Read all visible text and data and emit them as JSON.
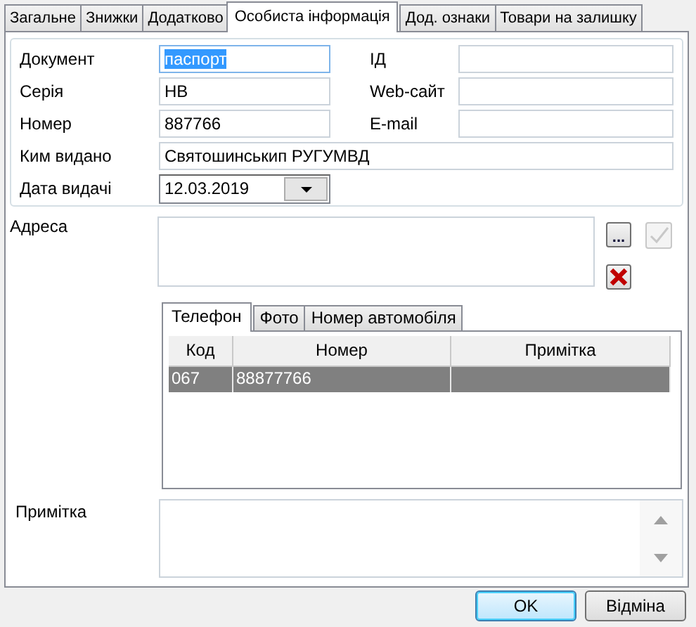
{
  "tabs": [
    {
      "label": "Загальне",
      "selected": false
    },
    {
      "label": "Знижки",
      "selected": false
    },
    {
      "label": "Додатково",
      "selected": false
    },
    {
      "label": "Особиста інформація",
      "selected": true
    },
    {
      "label": "Дод. ознаки",
      "selected": false
    },
    {
      "label": "Товари на залишку",
      "selected": false
    }
  ],
  "personal": {
    "document": {
      "label": "Документ",
      "value": "паспорт",
      "highlighted": true
    },
    "id": {
      "label": "ІД"
    },
    "series": {
      "label": "Серія",
      "value": "НВ"
    },
    "website": {
      "label": "Web-сайт"
    },
    "number": {
      "label": "Номер",
      "value": "887766"
    },
    "email": {
      "label": "E-mail"
    },
    "issued_by": {
      "label": "Ким видано",
      "value": "Святошинськип РУГУМВД"
    },
    "issue_date": {
      "label": "Дата видачі",
      "value": "12.03.2019"
    }
  },
  "address": {
    "label": "Адреса",
    "browse_button": "...",
    "confirm_disabled": true
  },
  "contact_tabs": [
    {
      "label": "Телефон",
      "selected": true
    },
    {
      "label": "Фото",
      "selected": false
    },
    {
      "label": "Номер автомобіля",
      "selected": false
    }
  ],
  "phones": {
    "columns": [
      "Код",
      "Номер",
      "Примітка"
    ],
    "rows": [
      {
        "cells": [
          "067",
          "88877766",
          ""
        ],
        "selected": true
      }
    ]
  },
  "note": {
    "label": "Примітка"
  },
  "buttons": [
    {
      "label": "OK",
      "default": true
    },
    {
      "label": "Відміна",
      "default": false
    }
  ]
}
